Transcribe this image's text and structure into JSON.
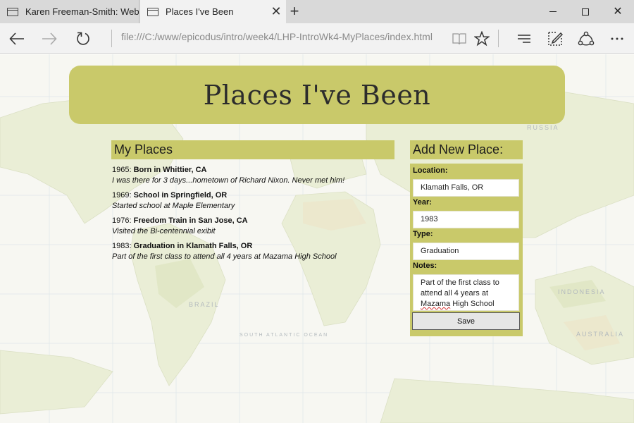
{
  "browser": {
    "tabs": [
      {
        "title": "Karen Freeman-Smith: Web",
        "active": false
      },
      {
        "title": "Places I've Been",
        "active": true
      }
    ],
    "address_url": "file:///C:/www/epicodus/intro/week4/LHP-IntroWk4-MyPlaces/index.html",
    "icons": {
      "back": "arrow-left-icon",
      "forward": "arrow-right-icon",
      "refresh": "refresh-icon",
      "reading_view": "book-icon",
      "favorite": "star-icon",
      "hub": "hamburger-icon",
      "web_note": "pen-note-icon",
      "share": "share-icon",
      "more": "ellipsis-icon"
    }
  },
  "page": {
    "title": "Places I've Been",
    "colors": {
      "accent": "#c9c96a",
      "text": "#2c2c2c"
    },
    "my_places": {
      "heading": "My Places",
      "items": [
        {
          "year": "1965",
          "location": "Born in Whittier, CA",
          "note": "I was there for 3 days...hometown of Richard Nixon. Never met him!"
        },
        {
          "year": "1969",
          "location": "School in Springfield, OR",
          "note": "Started school at Maple Elementary"
        },
        {
          "year": "1976",
          "location": "Freedom Train in San Jose, CA",
          "note": "Visited the Bi-centennial exibit"
        },
        {
          "year": "1983",
          "location": "Graduation in Klamath Falls, OR",
          "note": "Part of the first class to attend all 4 years at Mazama High School"
        }
      ]
    },
    "add_form": {
      "heading": "Add New Place:",
      "location_label": "Location:",
      "location_value": "Klamath Falls, OR",
      "year_label": "Year:",
      "year_value": "1983",
      "type_label": "Type:",
      "type_value": "Graduation",
      "notes_label": "Notes:",
      "notes_value_line1": "Part of the first class to",
      "notes_value_line2": "attend all 4 years at",
      "notes_value_misspelled": "Mazama",
      "notes_value_line3_rest": " High School",
      "save_label": "Save"
    },
    "map_labels": [
      "RUSSIA",
      "BRAZIL",
      "INDONESIA",
      "AUSTRALIA",
      "SOUTH ATLANTIC OCEAN"
    ]
  }
}
